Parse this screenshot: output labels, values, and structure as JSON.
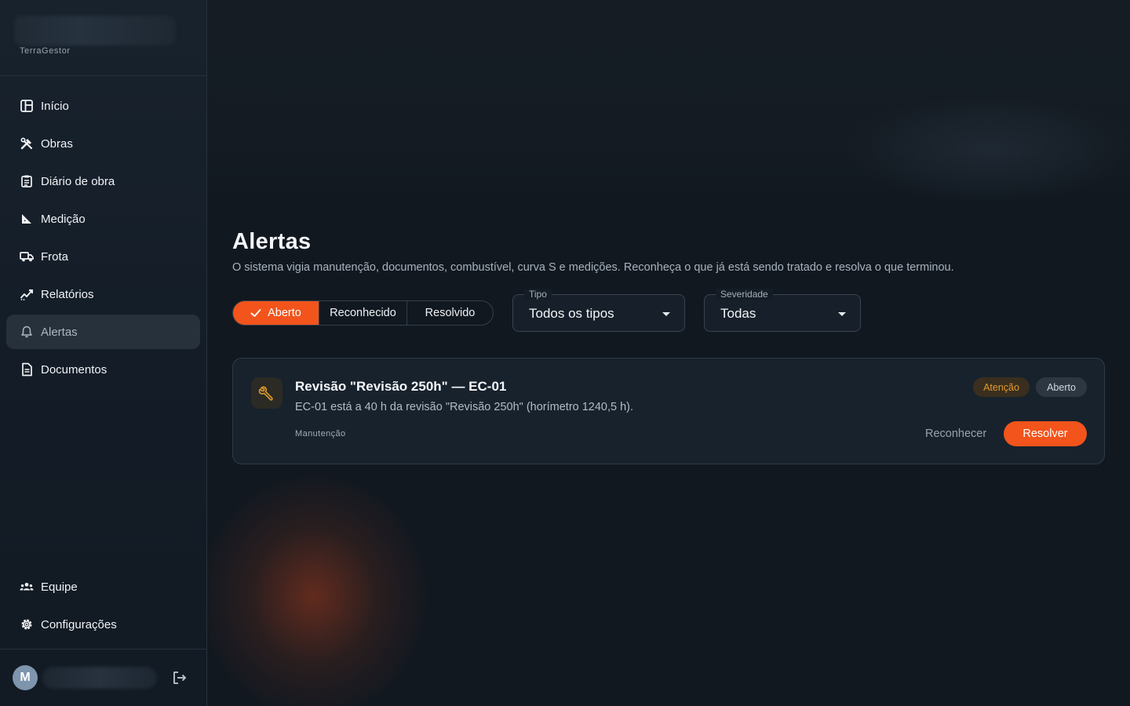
{
  "brand": {
    "subtitle": "TerraGestor"
  },
  "sidebar": {
    "items": [
      {
        "label": "Início",
        "icon": "dashboard-icon"
      },
      {
        "label": "Obras",
        "icon": "tools-icon"
      },
      {
        "label": "Diário de obra",
        "icon": "clipboard-icon"
      },
      {
        "label": "Medição",
        "icon": "ruler-triangle-icon"
      },
      {
        "label": "Frota",
        "icon": "truck-icon"
      },
      {
        "label": "Relatórios",
        "icon": "trend-chart-icon"
      },
      {
        "label": "Alertas",
        "icon": "bell-icon",
        "active": true
      },
      {
        "label": "Documentos",
        "icon": "document-icon"
      }
    ],
    "bottom_items": [
      {
        "label": "Equipe",
        "icon": "team-icon"
      },
      {
        "label": "Configurações",
        "icon": "gear-icon"
      }
    ],
    "user": {
      "avatar_initial": "M"
    }
  },
  "page": {
    "title": "Alertas",
    "description": "O sistema vigia manutenção, documentos, combustível, curva S e medições. Reconheça o que já está sendo tratado e resolva o que terminou."
  },
  "filters": {
    "status_tabs": [
      "Aberto",
      "Reconhecido",
      "Resolvido"
    ],
    "selected_status": "Aberto",
    "tipo": {
      "caption": "Tipo",
      "value": "Todos os tipos"
    },
    "severidade": {
      "caption": "Severidade",
      "value": "Todas"
    }
  },
  "alerts": [
    {
      "icon": "wrench-icon",
      "title": "Revisão \"Revisão 250h\" — EC-01",
      "body": "EC-01 está a 40 h da revisão \"Revisão 250h\" (horímetro 1240,5 h).",
      "category": "Manutenção",
      "severity": "Atenção",
      "status": "Aberto",
      "acknowledge_label": "Reconhecer",
      "resolve_label": "Resolver"
    }
  ],
  "colors": {
    "accent": "#f2541b",
    "background": "#111820",
    "sidebar": "#18222d",
    "warning": "#e09b2d"
  }
}
